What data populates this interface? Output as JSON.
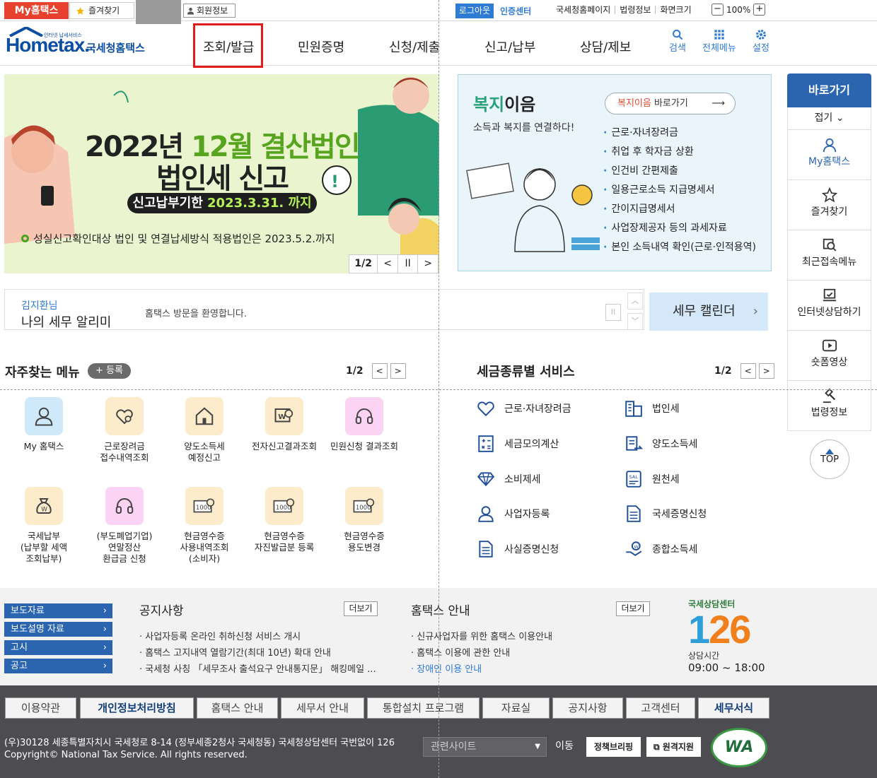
{
  "topbar": {
    "my_hometax": "My홈택스",
    "favorites": "즐겨찾기",
    "member_info": "회원정보",
    "logout": "로그아웃",
    "cert_center": "인증센터",
    "links": [
      "국세청홈페이지",
      "법령정보",
      "화면크기"
    ],
    "zoom_minus": "−",
    "zoom_value": "100%",
    "zoom_plus": "+"
  },
  "header": {
    "logo_text": "Hometax.",
    "logo_sub": "인터넷 납세서비스",
    "logo_korean": "국세청홈택스",
    "nav": [
      "조회/발급",
      "민원증명",
      "신청/제출",
      "신고/납부",
      "상담/제보"
    ],
    "active_nav": "조회/발급",
    "icons": [
      {
        "label": "검색",
        "icon": "search-icon"
      },
      {
        "label": "전체메뉴",
        "icon": "grid-menu-icon"
      },
      {
        "label": "설정",
        "icon": "gear-icon"
      }
    ]
  },
  "banner_main": {
    "title_prefix": "2022년 ",
    "title_highlight": "12월 결산법인",
    "title_line2": "법인세 신고",
    "pill_prefix": "신고납부기한 ",
    "pill_highlight": "2023.3.31. 까지",
    "note": "성실신고확인대상 법인 및 연결납세방식 적용법인은 2023.5.2.까지",
    "page": "1/2",
    "prev": "<",
    "pause": "II",
    "next": ">"
  },
  "banner_welfare": {
    "title_highlight": "복지",
    "title_rest": "이음",
    "subtitle": "소득과 복지를 연결하다!",
    "button_highlight": "복지이음",
    "button_rest": " 바로가기",
    "items": [
      "근로·자녀장려금",
      "취업 후 학자금 상환",
      "인건비 간편제출",
      "일용근로소득 지급명세서",
      "간이지급명세서",
      "사업장제공자 등의 과세자료",
      "본인 소득내역 확인(근로·인적용역)"
    ]
  },
  "quickbar": {
    "title": "바로가기",
    "fold": "접기",
    "items": [
      {
        "label": "My홈택스",
        "icon": "person-icon"
      },
      {
        "label": "즐겨찾기",
        "icon": "star-icon"
      },
      {
        "label": "최근접속메뉴",
        "icon": "recent-search-icon"
      },
      {
        "label": "인터넷상담하기",
        "icon": "consult-icon"
      },
      {
        "label": "숏폼영상",
        "icon": "play-icon"
      },
      {
        "label": "법령정보",
        "icon": "gavel-icon"
      }
    ],
    "top": "TOP"
  },
  "notice_bar": {
    "user": "김지환님",
    "title": "나의 세무 알리미",
    "message": "홈택스 방문을 환영합니다.",
    "calendar": "세무 캘린더"
  },
  "frequent_menu": {
    "title": "자주찾는 메뉴",
    "register": "등록",
    "page": "1/2",
    "items": [
      {
        "label": "My 홈택스",
        "icon": "person-icon",
        "bg": "#cfe9fb"
      },
      {
        "label": "근로장려금\n접수내역조회",
        "icon": "heart-search-icon",
        "bg": "#fdeccc"
      },
      {
        "label": "양도소득세\n예정신고",
        "icon": "house-icon",
        "bg": "#fdeccc"
      },
      {
        "label": "전자신고결과조회",
        "icon": "won-search-icon",
        "bg": "#fdeccc"
      },
      {
        "label": "민원신청 결과조회",
        "icon": "headset-icon",
        "bg": "#fbd3f3"
      },
      {
        "label": "국세납부\n(납부할 세액\n조회납부)",
        "icon": "money-bag-icon",
        "bg": "#fdeccc"
      },
      {
        "label": "(부도폐업기업)\n연말정산\n환급금 신청",
        "icon": "headset-icon",
        "bg": "#fbd3f3"
      },
      {
        "label": "현금영수증\n사용내역조회\n(소비자)",
        "icon": "receipt-1000-icon",
        "bg": "#fdeccc"
      },
      {
        "label": "현금영수증\n자진발급분 등록",
        "icon": "receipt-1000-icon",
        "bg": "#fdeccc"
      },
      {
        "label": "현금영수증\n용도변경",
        "icon": "receipt-1000-icon",
        "bg": "#fdeccc"
      }
    ]
  },
  "tax_services": {
    "title": "세금종류별 서비스",
    "page": "1/2",
    "items": [
      {
        "label": "근로·자녀장려금",
        "icon": "heart-hands-icon"
      },
      {
        "label": "법인세",
        "icon": "building-icon"
      },
      {
        "label": "세금모의계산",
        "icon": "calculator-icon"
      },
      {
        "label": "양도소득세",
        "icon": "transfer-icon"
      },
      {
        "label": "소비제세",
        "icon": "diamond-icon"
      },
      {
        "label": "원천세",
        "icon": "sale-doc-icon"
      },
      {
        "label": "사업자등록",
        "icon": "person-icon"
      },
      {
        "label": "국세증명신청",
        "icon": "document-icon"
      },
      {
        "label": "사실증명신청",
        "icon": "document-icon"
      },
      {
        "label": "종합소득세",
        "icon": "won-hand-icon"
      }
    ]
  },
  "side_links": [
    "보도자료",
    "보도설명 자료",
    "고시",
    "공고"
  ],
  "notices": {
    "title": "공지사항",
    "more": "더보기",
    "items": [
      "사업자등록 온라인 취하신청 서비스 개시",
      "홈택스 고지내역 열람기간(최대 10년) 확대 안내",
      "국세청 사칭 「세무조사 출석요구 안내통지문」 해킹메일 ..."
    ]
  },
  "guide": {
    "title": "홈택스 안내",
    "more": "더보기",
    "items": [
      "신규사업자를 위한 홈택스 이용안내",
      "홈택스 이용에 관한 안내",
      "장애인 이용 안내"
    ]
  },
  "center": {
    "small": "국세상담센터",
    "number_1": "1",
    "number_rest": "26",
    "hours_label": "상담시간",
    "hours": "09:00 ~ 18:00"
  },
  "footer": {
    "tabs": [
      "이용약관",
      "개인정보처리방침",
      "홈택스 안내",
      "세무서 안내",
      "통합설치 프로그램",
      "자료실",
      "공지사항",
      "고객센터",
      "세무서식"
    ],
    "address": "(우)30128 세종특별자치시 국세청로 8-14 (정부세종2청사 국세청동) 국세청상담센터 국번없이 126",
    "copyright": "Copyright© National Tax Service. All rights reserved.",
    "related": "관련사이트",
    "go": "이동",
    "badge1": "정책브리핑",
    "badge2": "원격지원",
    "wa": "WA"
  }
}
